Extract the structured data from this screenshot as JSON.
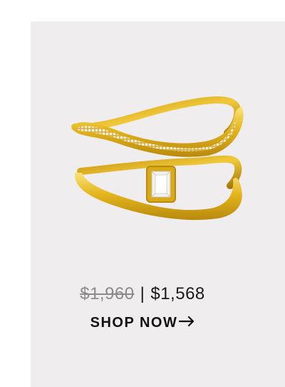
{
  "product": {
    "image_icon": "gold-diamond-ring-image"
  },
  "price": {
    "original": "$1,960",
    "separator": "|",
    "sale": "$1,568"
  },
  "cta": {
    "label": "SHOP NOW",
    "icon": "arrow-right-icon"
  },
  "colors": {
    "card_background": "#efedee",
    "gold": "#e2b417",
    "text": "#111111",
    "muted_text": "#8b8b8b"
  }
}
